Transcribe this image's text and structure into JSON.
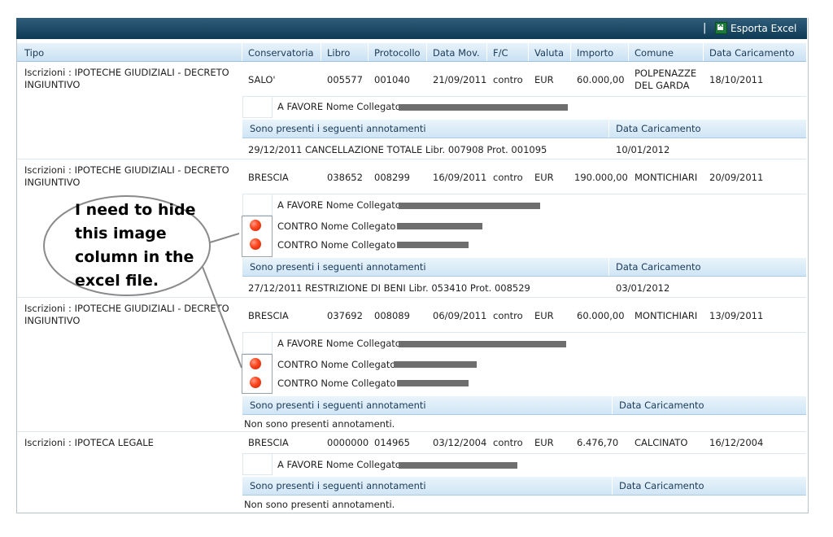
{
  "toolbar": {
    "export_label": "Esporta Excel",
    "separator": "|"
  },
  "columns": [
    "Tipo",
    "Conservatoria",
    "Libro",
    "Protocollo",
    "Data Mov.",
    "F/C",
    "Valuta",
    "Importo",
    "Comune",
    "Data Caricamento"
  ],
  "records": [
    {
      "tipo": "Iscrizioni : IPOTECHE GIUDIZIALI - DECRETO INGIUNTIVO",
      "conservatoria": "SALO'",
      "libro": "005577",
      "protocollo": "001040",
      "data_mov": "21/09/2011",
      "fc": "contro",
      "valuta": "EUR",
      "importo": "60.000,00",
      "comune": "POLPENAZZE DEL GARDA",
      "data_caricamento": "18/10/2011",
      "favore": "A FAVORE Nome Collegato :",
      "contro": [],
      "annot_header": "Sono presenti i seguenti annotamenti",
      "annot_date_header": "Data Caricamento",
      "annotation": "29/12/2011   CANCELLAZIONE TOTALE   Libr. 007908   Prot. 001095",
      "annotation_date": "10/01/2012"
    },
    {
      "tipo": "Iscrizioni : IPOTECHE GIUDIZIALI - DECRETO INGIUNTIVO",
      "conservatoria": "BRESCIA",
      "libro": "038652",
      "protocollo": "008299",
      "data_mov": "16/09/2011",
      "fc": "contro",
      "valuta": "EUR",
      "importo": "190.000,00",
      "comune": "MONTICHIARI",
      "data_caricamento": "20/09/2011",
      "favore": "A FAVORE Nome Collegato :",
      "contro": [
        "CONTRO Nome Collegato :",
        "CONTRO Nome Collegato :"
      ],
      "annot_header": "Sono presenti i seguenti annotamenti",
      "annot_date_header": "Data Caricamento",
      "annotation": "27/12/2011   RESTRIZIONE DI BENI   Libr. 053410   Prot. 008529",
      "annotation_date": "03/01/2012"
    },
    {
      "tipo": "Iscrizioni : IPOTECHE GIUDIZIALI - DECRETO INGIUNTIVO",
      "conservatoria": "BRESCIA",
      "libro": "037692",
      "protocollo": "008089",
      "data_mov": "06/09/2011",
      "fc": "contro",
      "valuta": "EUR",
      "importo": "60.000,00",
      "comune": "MONTICHIARI",
      "data_caricamento": "13/09/2011",
      "favore": "A FAVORE Nome Collegato :",
      "contro": [
        "CONTRO Nome Collegato :",
        "CONTRO Nome Collegato :"
      ],
      "annot_header": "Sono presenti i seguenti annotamenti",
      "annot_date_header": "Data Caricamento",
      "annotation": "Non sono presenti annotamenti.",
      "annotation_date": ""
    },
    {
      "tipo": "Iscrizioni : IPOTECA LEGALE",
      "conservatoria": "BRESCIA",
      "libro": "0000000",
      "protocollo": "014965",
      "data_mov": "03/12/2004",
      "fc": "contro",
      "valuta": "EUR",
      "importo": "6.476,70",
      "comune": "CALCINATO",
      "data_caricamento": "16/12/2004",
      "favore": "A FAVORE Nome Collegato :",
      "contro": [],
      "annot_header": "Sono presenti i seguenti annotamenti",
      "annot_date_header": "Data Caricamento",
      "annotation": "Non sono presenti annotamenti.",
      "annotation_date": ""
    }
  ],
  "callout": {
    "text": "I need to hide this image column in the excel file."
  },
  "colors": {
    "toolbar": "#1b4766",
    "header_bg": "#d6e9f7",
    "status_red": "#ff4a22"
  }
}
